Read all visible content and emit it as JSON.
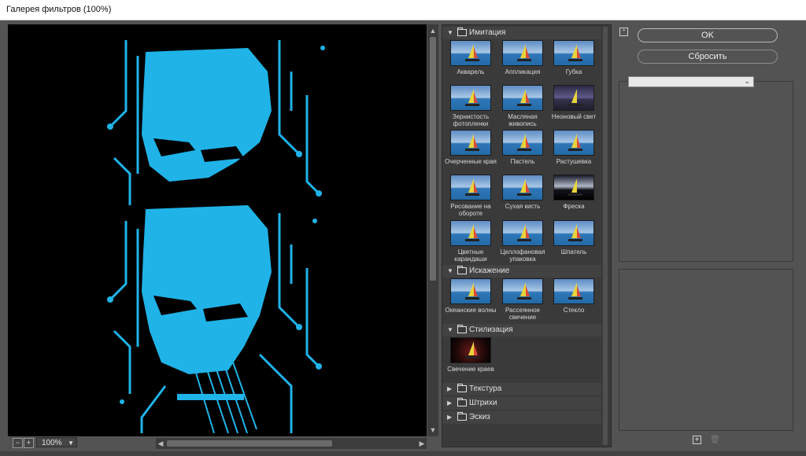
{
  "window": {
    "title": "Галерея фильтров (100%)"
  },
  "preview": {
    "zoom": "100%"
  },
  "buttons": {
    "ok": "OK",
    "reset": "Сбросить"
  },
  "categories": [
    {
      "name": "Имитация",
      "expanded": true,
      "filters": [
        "Акварель",
        "Аппликация",
        "Губка",
        "Зернистость фотопленки",
        "Масляная живопись",
        "Неоновый свет",
        "Очерченные края",
        "Пастель",
        "Растушевка",
        "Рисование на обороте",
        "Сухая кисть",
        "Фреска",
        "Цветные карандаши",
        "Целлофановая упаковка",
        "Шпатель"
      ]
    },
    {
      "name": "Искажение",
      "expanded": true,
      "filters": [
        "Океанские волны",
        "Рассеянное свечение",
        "Стекло"
      ]
    },
    {
      "name": "Стилизация",
      "expanded": true,
      "filters": [
        "Свечение краев"
      ]
    },
    {
      "name": "Текстура",
      "expanded": false,
      "filters": []
    },
    {
      "name": "Штрихи",
      "expanded": false,
      "filters": []
    },
    {
      "name": "Эскиз",
      "expanded": false,
      "filters": []
    }
  ],
  "colors": {
    "preview_accent": "#1fb3e8",
    "background": "#535353",
    "panel": "#3a3a3a"
  }
}
